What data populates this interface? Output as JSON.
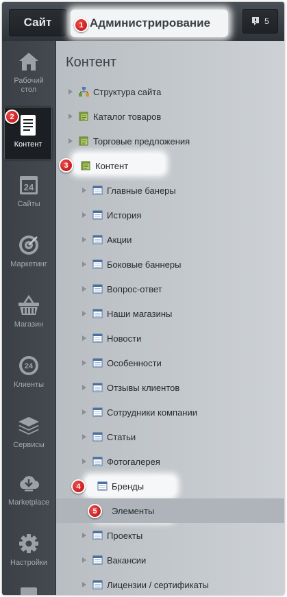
{
  "topbar": {
    "site_tab": "Сайт",
    "admin_tab": "Администрирование",
    "notifications_count": "5"
  },
  "callouts": [
    "1",
    "2",
    "3",
    "4",
    "5"
  ],
  "sidebar": {
    "items": [
      {
        "label": "Рабочий стол",
        "icon": "house-icon"
      },
      {
        "label": "Контент",
        "icon": "document-icon",
        "active": true
      },
      {
        "label": "Сайты",
        "icon": "calendar-24-icon"
      },
      {
        "label": "Маркетинг",
        "icon": "target-icon"
      },
      {
        "label": "Магазин",
        "icon": "basket-icon"
      },
      {
        "label": "Клиенты",
        "icon": "clients-24-icon"
      },
      {
        "label": "Сервисы",
        "icon": "layers-icon"
      },
      {
        "label": "Marketplace",
        "icon": "cloud-download-icon"
      },
      {
        "label": "Настройки",
        "icon": "gear-icon"
      }
    ]
  },
  "main": {
    "title": "Контент",
    "tree": [
      {
        "label": "Структура сайта"
      },
      {
        "label": "Каталог товаров"
      },
      {
        "label": "Торговые предложения"
      },
      {
        "label": "Контент"
      },
      {
        "label": "Главные банеры"
      },
      {
        "label": "История"
      },
      {
        "label": "Акции"
      },
      {
        "label": "Боковые баннеры"
      },
      {
        "label": "Вопрос-ответ"
      },
      {
        "label": "Наши магазины"
      },
      {
        "label": "Новости"
      },
      {
        "label": "Особенности"
      },
      {
        "label": "Отзывы клиентов"
      },
      {
        "label": "Сотрудники компании"
      },
      {
        "label": "Статьи"
      },
      {
        "label": "Фотогалерея"
      },
      {
        "label": "Бренды"
      },
      {
        "label": "Элементы"
      },
      {
        "label": "Проекты"
      },
      {
        "label": "Вакансии"
      },
      {
        "label": "Лицензии / сертификаты"
      }
    ]
  },
  "colors": {
    "callout": "#d41f1f",
    "sidebar": "#40454b",
    "main_bg": "#c6cbcf"
  }
}
